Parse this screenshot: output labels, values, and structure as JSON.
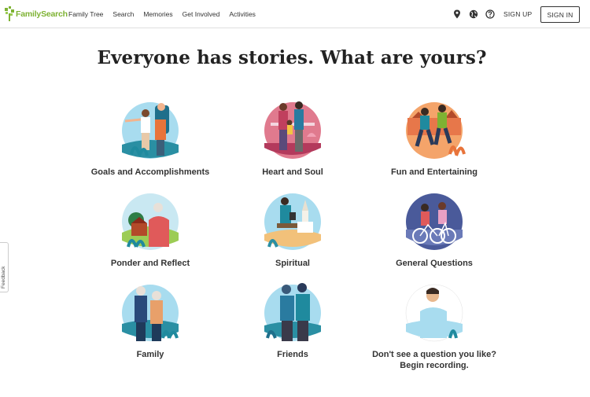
{
  "header": {
    "logo_text": "FamilySearch",
    "nav": [
      "Family Tree",
      "Search",
      "Memories",
      "Get Involved",
      "Activities"
    ],
    "icons": [
      "location-icon",
      "globe-icon",
      "help-icon"
    ],
    "signup_label": "SIGN UP",
    "signin_label": "SIGN IN"
  },
  "headline": "Everyone has stories. What are yours?",
  "categories": [
    {
      "label": "Goals and Accomplishments"
    },
    {
      "label": "Heart and Soul"
    },
    {
      "label": "Fun and Entertaining"
    },
    {
      "label": "Ponder and Reflect"
    },
    {
      "label": "Spiritual"
    },
    {
      "label": "General Questions"
    },
    {
      "label": "Family"
    },
    {
      "label": "Friends"
    },
    {
      "label": "Don't see a question you like?\nBegin recording."
    }
  ],
  "feedback_label": "Feedback",
  "colors": {
    "brand_green": "#7eb233",
    "teal": "#1f8a9e",
    "orange": "#e8743b",
    "sky": "#a8dcef"
  }
}
